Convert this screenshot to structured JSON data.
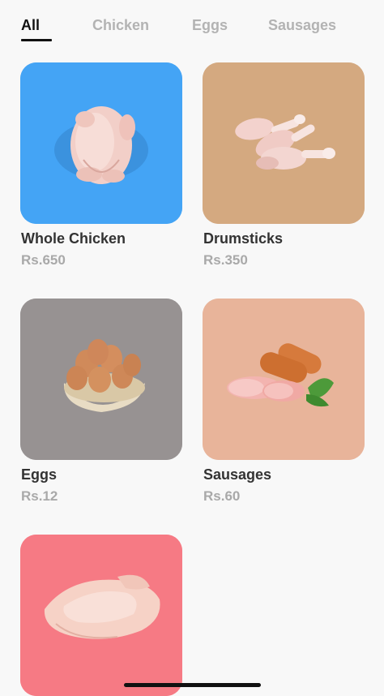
{
  "tabs": [
    {
      "label": "All",
      "active": true
    },
    {
      "label": "Chicken",
      "active": false
    },
    {
      "label": "Eggs",
      "active": false
    },
    {
      "label": "Sausages",
      "active": false
    }
  ],
  "products": [
    {
      "name": "Whole Chicken",
      "price": "Rs.650",
      "bg_color": "#44a4f5",
      "icon": "whole-chicken-icon"
    },
    {
      "name": "Drumsticks",
      "price": "Rs.350",
      "bg_color": "#d4a980",
      "icon": "drumsticks-icon"
    },
    {
      "name": "Eggs",
      "price": "Rs.12",
      "bg_color": "#979292",
      "icon": "eggs-basket-icon"
    },
    {
      "name": "Sausages",
      "price": "Rs.60",
      "bg_color": "#e8b49a",
      "icon": "sausages-icon"
    },
    {
      "name": "",
      "price": "",
      "bg_color": "#f67a84",
      "icon": "chicken-breast-icon"
    }
  ],
  "colors": {
    "background": "#f8f8f8",
    "tab_active": "#111111",
    "tab_inactive": "#b3b3b3",
    "name_text": "#333333",
    "price_text": "#a9a9a9"
  }
}
